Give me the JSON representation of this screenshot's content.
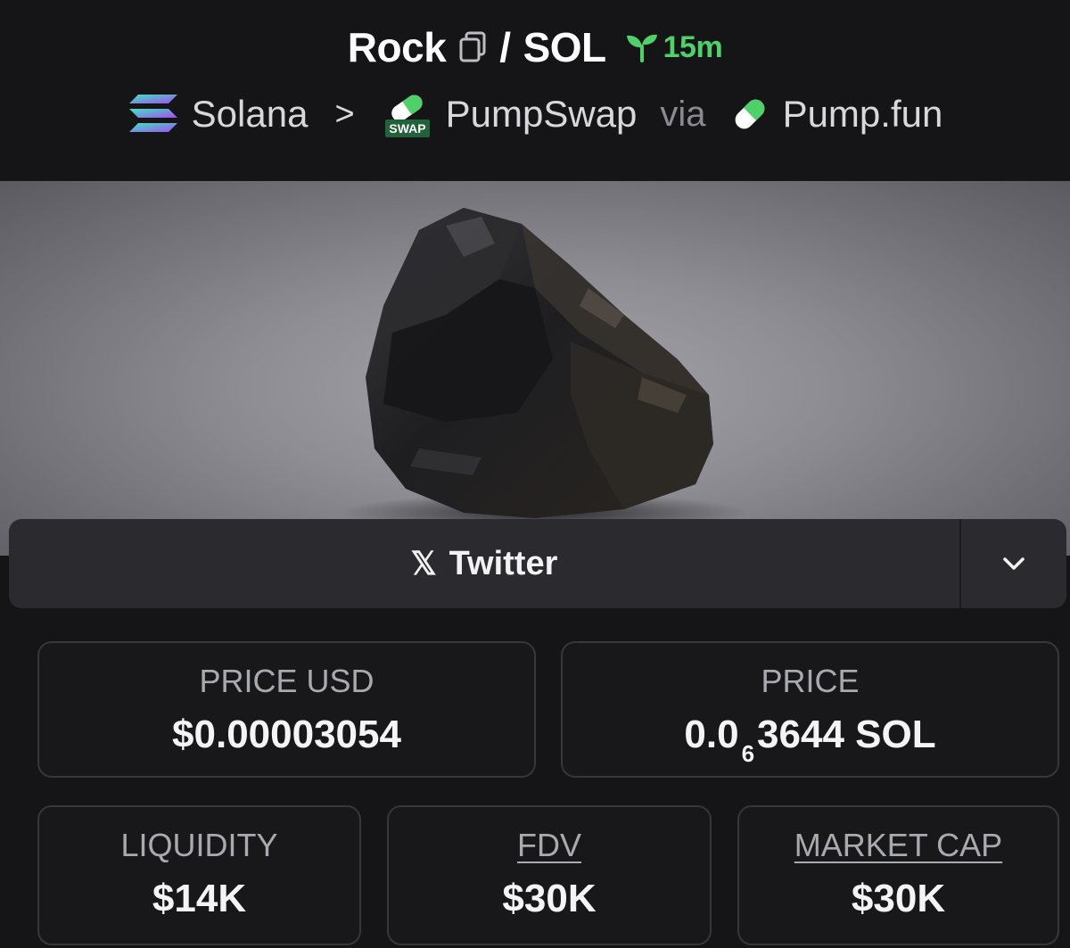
{
  "header": {
    "token": "Rock",
    "separator": "/",
    "quote": "SOL",
    "age": "15m",
    "chain": "Solana",
    "path_sep": ">",
    "dex": "PumpSwap",
    "dex_badge": "SWAP",
    "via": "via",
    "launchpad": "Pump.fun"
  },
  "social": {
    "x_glyph": "𝕏",
    "label": "Twitter"
  },
  "stats": {
    "price_usd": {
      "label": "PRICE USD",
      "value": "$0.00003054"
    },
    "price": {
      "label": "PRICE",
      "prefix": "0.0",
      "zeros": "6",
      "suffix": "3644 SOL"
    },
    "liquidity": {
      "label": "LIQUIDITY",
      "value": "$14K"
    },
    "fdv": {
      "label": "FDV",
      "value": "$30K"
    },
    "market_cap": {
      "label": "MARKET CAP",
      "value": "$30K"
    }
  },
  "colors": {
    "background": "#151518",
    "accent_green": "#4fd16a",
    "card_border": "#36363b",
    "button_bg": "#2b2b2f"
  },
  "icons": [
    "copy-icon",
    "seedling-icon",
    "solana-logo-icon",
    "pumpswap-logo-icon",
    "pumpfun-pill-icon",
    "x-logo-icon",
    "chevron-down-icon"
  ]
}
